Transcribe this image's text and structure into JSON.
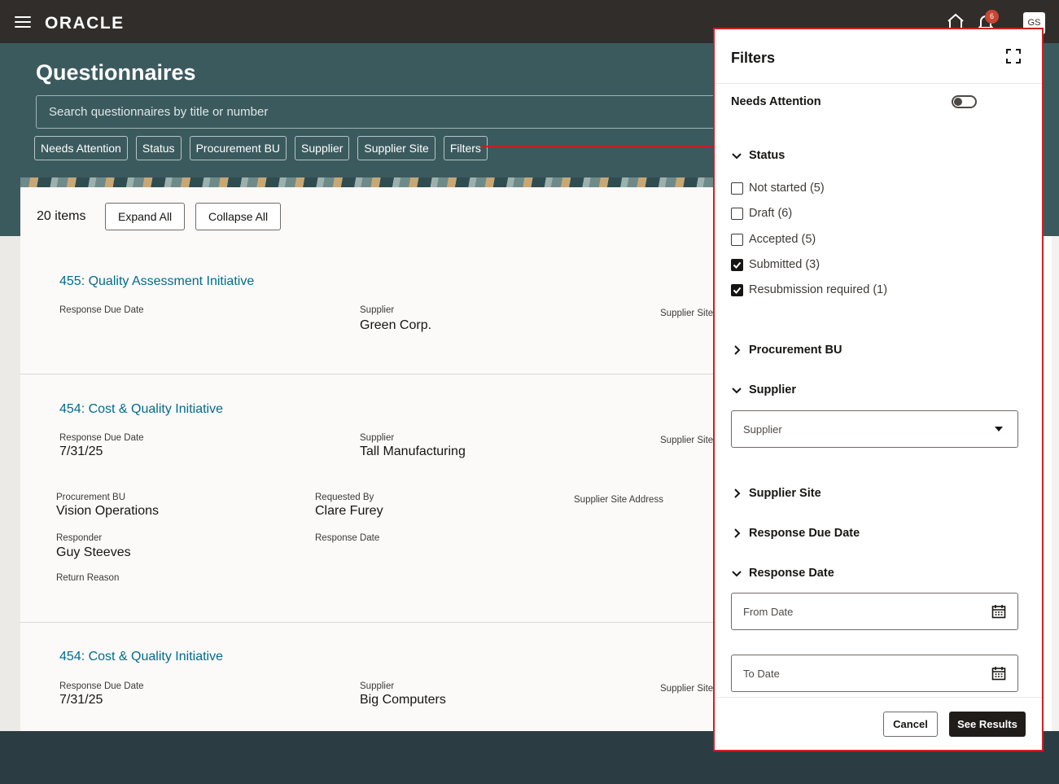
{
  "app": {
    "brand": "ORACLE",
    "notification_count": "6",
    "user_initials": "GS"
  },
  "page": {
    "title": "Questionnaires",
    "search_placeholder": "Search questionnaires by title or number"
  },
  "filter_chips": [
    "Needs Attention",
    "Status",
    "Procurement BU",
    "Supplier",
    "Supplier Site",
    "Filters"
  ],
  "toolbar": {
    "items_count": "20 items",
    "expand_all": "Expand All",
    "collapse_all": "Collapse All"
  },
  "labels": {
    "response_due_date": "Response Due Date",
    "supplier": "Supplier",
    "supplier_site": "Supplier Site",
    "procurement_bu": "Procurement BU",
    "requested_by": "Requested By",
    "supplier_site_address": "Supplier Site Address",
    "responder": "Responder",
    "response_date": "Response Date",
    "return_reason": "Return Reason"
  },
  "records": [
    {
      "title": "455: Quality Assessment Initiative",
      "response_due_date": "",
      "supplier": "Green Corp."
    },
    {
      "title": "454: Cost & Quality Initiative",
      "response_due_date": "7/31/25",
      "supplier": "Tall Manufacturing",
      "procurement_bu": "Vision Operations",
      "requested_by": "Clare Furey",
      "responder": "Guy Steeves"
    },
    {
      "title": "454: Cost & Quality Initiative",
      "response_due_date": "7/31/25",
      "supplier": "Big Computers"
    }
  ],
  "drawer": {
    "title": "Filters",
    "needs_attention_label": "Needs Attention",
    "needs_attention_on": false,
    "status": {
      "label": "Status",
      "expanded": true,
      "options": [
        {
          "label": "Not started (5)",
          "checked": false
        },
        {
          "label": "Draft (6)",
          "checked": false
        },
        {
          "label": "Accepted (5)",
          "checked": false
        },
        {
          "label": "Submitted (3)",
          "checked": true
        },
        {
          "label": "Resubmission required (1)",
          "checked": true
        }
      ]
    },
    "procurement_bu": {
      "label": "Procurement BU",
      "expanded": false
    },
    "supplier": {
      "label": "Supplier",
      "expanded": true,
      "placeholder": "Supplier"
    },
    "supplier_site": {
      "label": "Supplier Site",
      "expanded": false
    },
    "response_due_date": {
      "label": "Response Due Date",
      "expanded": false
    },
    "response_date": {
      "label": "Response Date",
      "expanded": true,
      "from_placeholder": "From Date",
      "to_placeholder": "To Date"
    },
    "cancel": "Cancel",
    "see_results": "See Results"
  },
  "colors": {
    "topbar": "#312d2a",
    "header_band": "#3b5a5e",
    "link": "#006b8f",
    "highlight": "#d01e23",
    "primary_button": "#1f1c1a"
  }
}
